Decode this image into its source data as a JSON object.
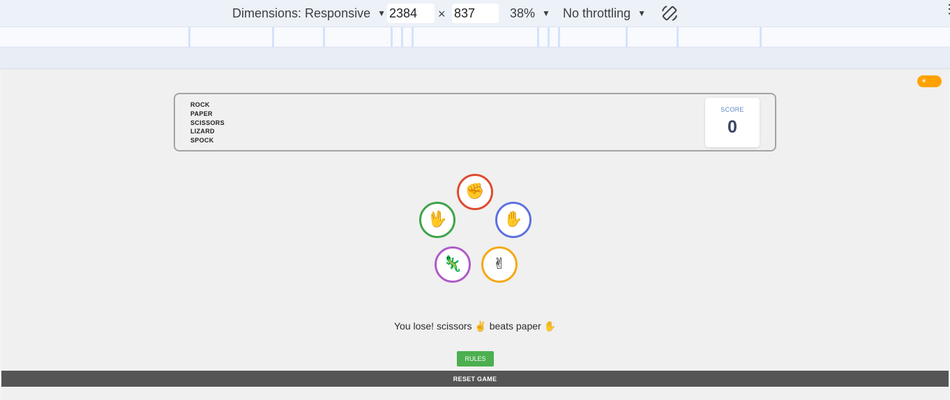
{
  "devtools": {
    "dimensions_label": "Dimensions: Responsive",
    "width_value": "2384",
    "times_symbol": "×",
    "height_value": "837",
    "zoom_label": "38%",
    "throttling_label": "No throttling",
    "caret": "▼",
    "more_icon": "⋮"
  },
  "game": {
    "title_words": [
      "ROCK",
      "PAPER",
      "SCISSORS",
      "LIZARD",
      "SPOCK"
    ],
    "score_label": "SCORE",
    "score_value": "0",
    "choices": [
      {
        "name": "rock",
        "emoji": "✊",
        "color": "#dd4a2f"
      },
      {
        "name": "paper",
        "emoji": "✋",
        "color": "#5d71e0"
      },
      {
        "name": "scissors",
        "emoji": "✌",
        "color": "#f4a814"
      },
      {
        "name": "lizard",
        "emoji": "🦎",
        "color": "#b05bc8"
      },
      {
        "name": "spock",
        "emoji": "🖖",
        "color": "#3fa34a"
      }
    ],
    "result_text": "You lose! scissors ✌ beats paper ✋",
    "rules_label": "RULES",
    "reset_label": "RESET GAME",
    "theme_toggle_color": "#ffa200"
  }
}
